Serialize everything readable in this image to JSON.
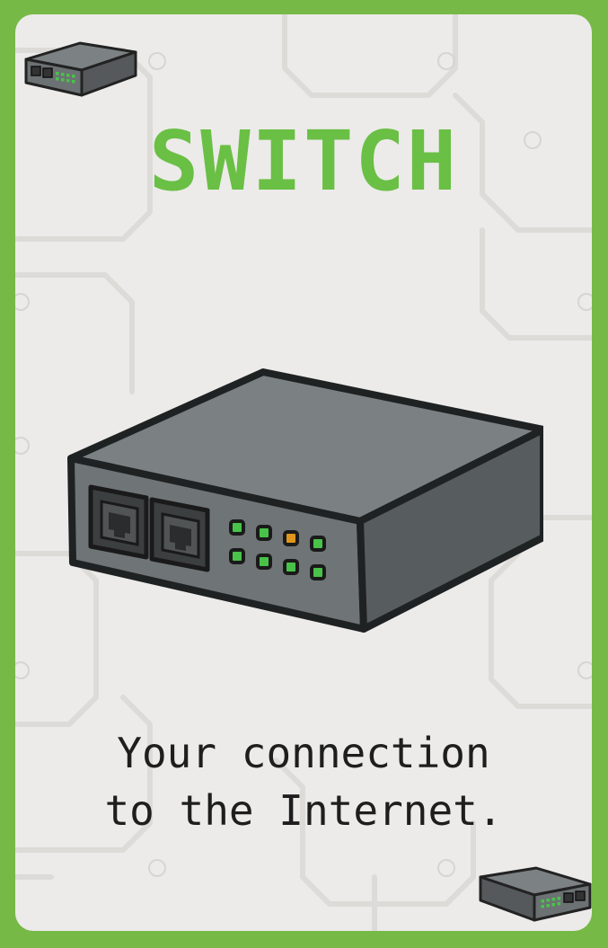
{
  "card": {
    "title": "SWITCH",
    "description_line1": "Your connection",
    "description_line2": "to the Internet.",
    "icon": "network-switch-icon",
    "colors": {
      "frame": "#76b947",
      "title": "#6abf45",
      "background": "#ecebe9",
      "device_body": "#6f7476",
      "led_green": "#49c24a",
      "led_amber": "#e0951f"
    }
  }
}
